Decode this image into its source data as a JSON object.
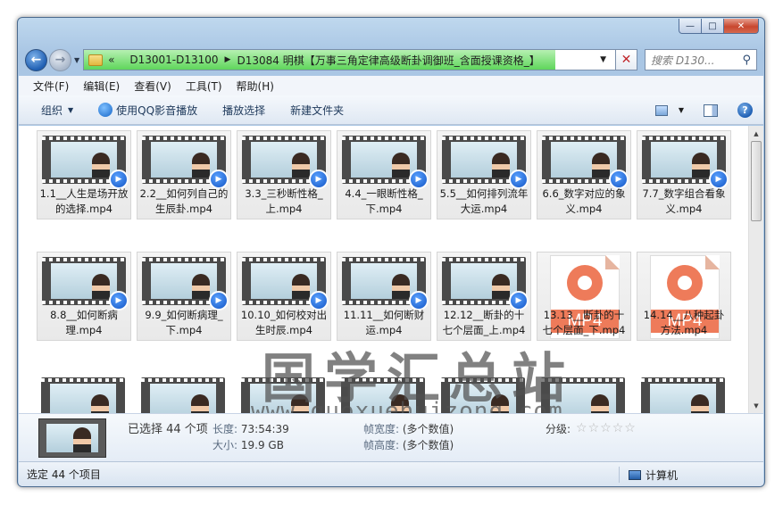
{
  "window": {
    "minimize": "—",
    "maximize": "□",
    "close": "✕"
  },
  "address": {
    "overflow": "«",
    "crumbs": [
      "D13001-D13100",
      "D13084 明棋【万事三角定律高级断卦调御班_含面授课资格_】"
    ],
    "search_placeholder": "搜索 D130..."
  },
  "menu": [
    "文件(F)",
    "编辑(E)",
    "查看(V)",
    "工具(T)",
    "帮助(H)"
  ],
  "toolbar": {
    "organize": "组织",
    "qq_play": "使用QQ影音播放",
    "play_selection": "播放选择",
    "new_folder": "新建文件夹"
  },
  "files": [
    {
      "label": "1.1__人生是场开放的选择.mp4",
      "kind": "video"
    },
    {
      "label": "2.2__如何列自己的生辰卦.mp4",
      "kind": "video"
    },
    {
      "label": "3.3_三秒断性格_上.mp4",
      "kind": "video"
    },
    {
      "label": "4.4_一眼断性格_下.mp4",
      "kind": "video"
    },
    {
      "label": "5.5__如何排列流年大运.mp4",
      "kind": "video"
    },
    {
      "label": "6.6_数字对应的象义.mp4",
      "kind": "video"
    },
    {
      "label": "7.7_数字组合看象义.mp4",
      "kind": "video"
    },
    {
      "label": "8.8__如何断病理.mp4",
      "kind": "video"
    },
    {
      "label": "9.9_如何断病理_下.mp4",
      "kind": "video"
    },
    {
      "label": "10.10_如何校对出生时辰.mp4",
      "kind": "video"
    },
    {
      "label": "11.11__如何断财运.mp4",
      "kind": "video"
    },
    {
      "label": "12.12__断卦的十七个层面_上.mp4",
      "kind": "video"
    },
    {
      "label": "13.13__断卦的十七个层面_下.mp4",
      "kind": "mp4"
    },
    {
      "label": "14.14__八种起卦方法.mp4",
      "kind": "mp4"
    },
    {
      "label": "",
      "kind": "video"
    },
    {
      "label": "",
      "kind": "video"
    },
    {
      "label": "",
      "kind": "video"
    },
    {
      "label": "",
      "kind": "video"
    },
    {
      "label": "",
      "kind": "video"
    },
    {
      "label": "",
      "kind": "video"
    },
    {
      "label": "",
      "kind": "video"
    }
  ],
  "mp4_badge": "MP4",
  "watermark": {
    "text": "国学汇总站",
    "url": "www.guoxuehuizong.com"
  },
  "details": {
    "selected": "已选择 44 个项",
    "length_key": "长度:",
    "length_val": "73:54:39",
    "size_key": "大小:",
    "size_val": "19.9 GB",
    "width_key": "帧宽度:",
    "width_val": "(多个数值)",
    "height_key": "帧高度:",
    "height_val": "(多个数值)",
    "rating_key": "分级:",
    "rating_stars": 0
  },
  "status": {
    "left": "选定 44 个项目",
    "right": "计算机"
  }
}
